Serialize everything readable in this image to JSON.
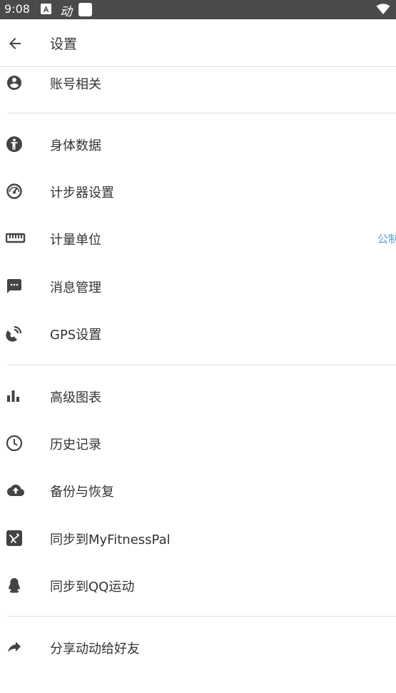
{
  "status_bar": {
    "time": "9:08",
    "app_glyph": "动"
  },
  "header": {
    "title": "设置"
  },
  "menu": [
    {
      "key": "account",
      "label": "账号相关",
      "icon": "account-circle-icon"
    },
    {
      "key": "body",
      "label": "身体数据",
      "icon": "body-person-icon"
    },
    {
      "key": "pedometer",
      "label": "计步器设置",
      "icon": "speedometer-icon"
    },
    {
      "key": "units",
      "label": "计量单位",
      "value": "公制",
      "icon": "ruler-icon"
    },
    {
      "key": "messages",
      "label": "消息管理",
      "icon": "message-icon"
    },
    {
      "key": "gps",
      "label": "GPS设置",
      "icon": "satellite-icon"
    },
    {
      "key": "charts",
      "label": "高级图表",
      "icon": "bar-chart-icon"
    },
    {
      "key": "history",
      "label": "历史记录",
      "icon": "clock-icon"
    },
    {
      "key": "backup",
      "label": "备份与恢复",
      "icon": "cloud-upload-icon"
    },
    {
      "key": "mfp",
      "label": "同步到MyFitnessPal",
      "icon": "myfitnesspal-icon"
    },
    {
      "key": "qq",
      "label": "同步到QQ运动",
      "icon": "qq-penguin-icon"
    },
    {
      "key": "share",
      "label": "分享动动给好友",
      "icon": "share-arrow-icon"
    }
  ],
  "colors": {
    "status_bar_bg": "#4a4a4a",
    "icon": "#444444",
    "value_text": "#5b9bd5",
    "divider": "#dedede"
  }
}
